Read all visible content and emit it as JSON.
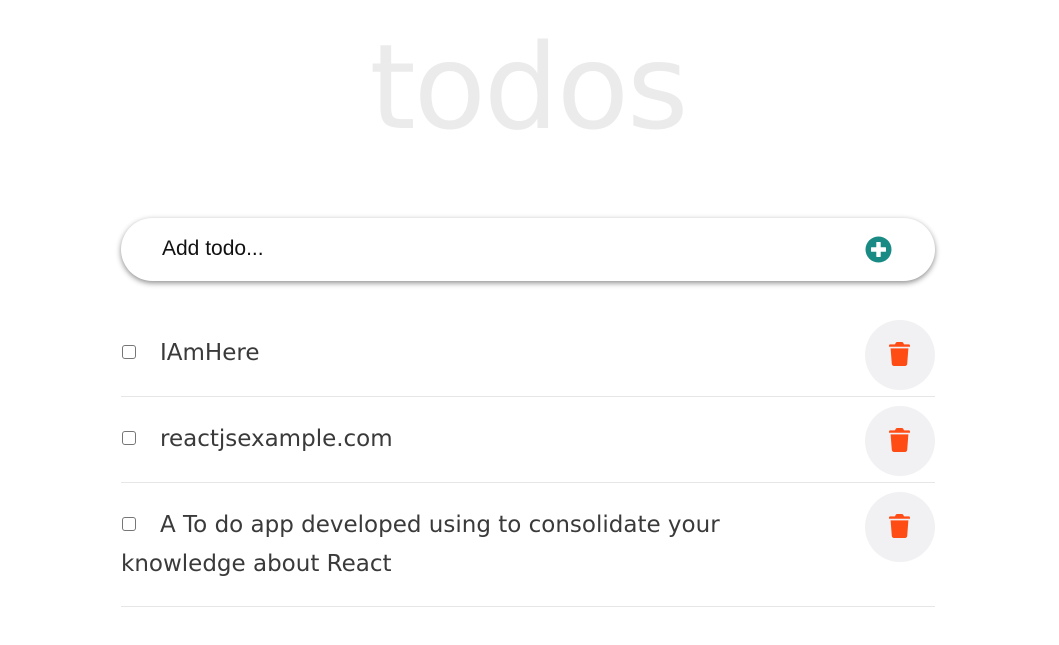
{
  "app": {
    "title": "todos"
  },
  "add_todo": {
    "placeholder": "Add todo..."
  },
  "todos": [
    {
      "text": "IAmHere",
      "done": false
    },
    {
      "text": "reactjsexample.com",
      "done": false
    },
    {
      "text": "A To do app developed using to consolidate your knowledge about React",
      "done": false
    }
  ],
  "icons": {
    "add": "plus-circle-icon",
    "delete": "trash-icon"
  },
  "colors": {
    "title": "#ebebeb",
    "add_icon": "#1a8b84",
    "delete_icon": "#ff4c14",
    "delete_bg": "#f1f1f3",
    "text": "#3a3a3a"
  }
}
